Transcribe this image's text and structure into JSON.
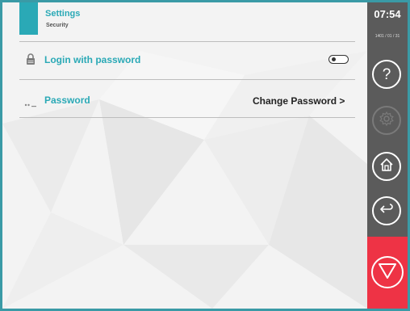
{
  "header": {
    "title": "Settings",
    "subtitle": "Security"
  },
  "rows": [
    {
      "label": "Login with password",
      "icon": "lock-icon",
      "control": "toggle",
      "toggle_on": false
    },
    {
      "label": "Password",
      "icon": "password-dots-icon",
      "action_label": "Change Password >"
    }
  ],
  "sidebar": {
    "time": "07:54",
    "date": "1401 / 01 / 31",
    "buttons": [
      {
        "icon": "help-icon",
        "text": "?"
      },
      {
        "icon": "gear-icon",
        "disabled": true
      },
      {
        "icon": "home-icon"
      },
      {
        "icon": "back-icon"
      },
      {
        "icon": "stop-icon"
      }
    ]
  },
  "colors": {
    "accent": "#2aa9b6",
    "sidebar": "#5b5b5b",
    "stop": "#ee3345",
    "frame": "#3a9aa6"
  }
}
